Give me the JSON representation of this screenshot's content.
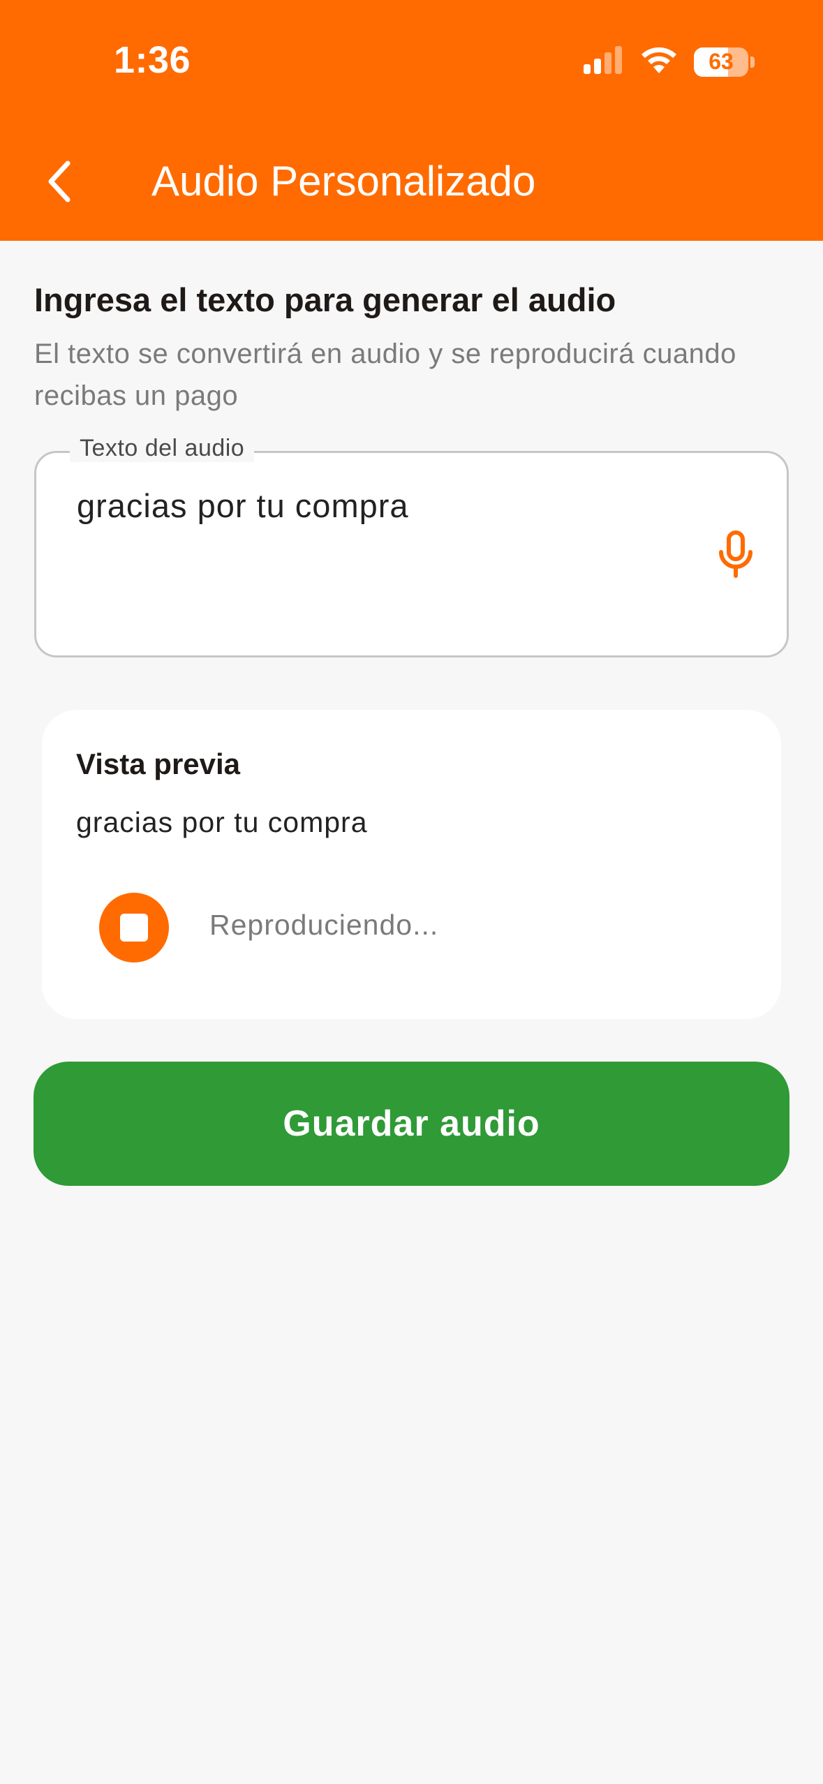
{
  "status_bar": {
    "time": "1:36",
    "battery": "63",
    "battery_level_percent": 63,
    "icons": [
      "signal-icon",
      "wifi-icon",
      "battery-icon"
    ]
  },
  "header": {
    "back_icon": "chevron-left-icon",
    "title": "Audio Personalizado"
  },
  "instructions": {
    "heading": "Ingresa el texto para generar el audio",
    "description": "El texto se convertirá en audio y se reproducirá cuando recibas un pago"
  },
  "audio_field": {
    "label": "Texto del audio",
    "value": "gracias por tu compra",
    "mic_icon": "microphone-icon"
  },
  "preview": {
    "title": "Vista previa",
    "text": "gracias por tu compra",
    "stop_icon": "stop-icon",
    "status": "Reproduciendo..."
  },
  "actions": {
    "save_label": "Guardar audio"
  },
  "colors": {
    "brand": "#ff6b00",
    "save_button": "#2f9a36",
    "background": "#f7f7f7"
  }
}
